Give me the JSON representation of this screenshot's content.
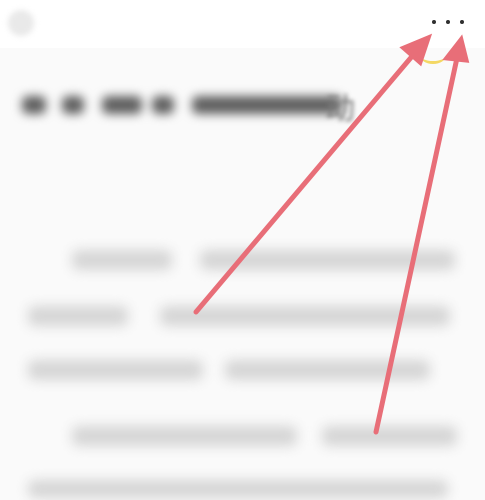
{
  "screen": {
    "background_color": "#fafafa",
    "topbar_color": "#ffffff"
  },
  "header": {
    "back_icon": "back-icon",
    "more_icon": "more-icon",
    "more_label": "•••"
  },
  "article": {
    "title_visible_fragment": "动",
    "title_rest_blurred": true,
    "paragraph_text_blurred": true
  },
  "annotations": {
    "arrow_color": "#e86e78",
    "highlight_color": "#f3d34a",
    "arrow_count": 2,
    "target": "more-icon"
  }
}
